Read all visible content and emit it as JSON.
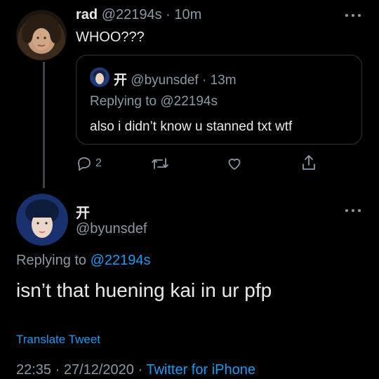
{
  "tweet1": {
    "name": "rad",
    "handle": "@22194s",
    "dot": "·",
    "time": "10m",
    "text": "WHOO???"
  },
  "quote": {
    "name": "开",
    "handle": "@byunsdef",
    "dot": "·",
    "time": "13m",
    "replying_prefix": "Replying to",
    "replying_handle": "@22194s",
    "text": "also i didn’t know u stanned txt wtf"
  },
  "actions": {
    "reply_count": "2"
  },
  "tweet2": {
    "name": "开",
    "handle": "@byunsdef",
    "replying_prefix": "Replying to",
    "replying_handle": "@22194s",
    "text": "isn’t that huening kai in ur pfp",
    "translate": "Translate Tweet",
    "timestamp": "22:35 · 27/12/2020 ·",
    "source": "Twitter for iPhone"
  },
  "icons": {
    "reply": "reply-icon",
    "retweet": "retweet-icon",
    "like": "heart-icon",
    "share": "share-icon",
    "more": "more-icon"
  },
  "colors": {
    "background": "#000000",
    "text": "#e7e9ea",
    "muted": "#8b98a5",
    "link": "#1d9bf0",
    "border": "#2f3336"
  }
}
